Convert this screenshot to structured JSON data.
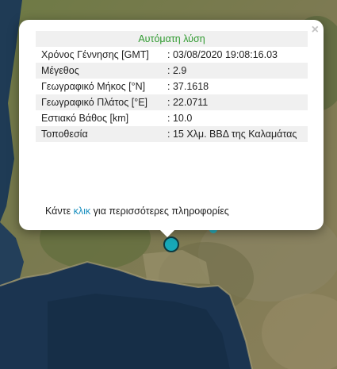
{
  "popup": {
    "title": "Αυτόματη λύση",
    "close_label": "×",
    "rows": [
      {
        "label": "Χρόνος Γέννησης [GMT]",
        "value": ": 03/08/2020 19:08:16.03"
      },
      {
        "label": "Μέγεθος",
        "value": ": 2.9"
      },
      {
        "label": "Γεωγραφικό Μήκος [°N]",
        "value": ": 37.1618"
      },
      {
        "label": "Γεωγραφικό Πλάτος [°E]",
        "value": ": 22.0711"
      },
      {
        "label": "Εστιακό Βάθος [km]",
        "value": ": 10.0"
      },
      {
        "label": "Τοποθεσία",
        "value": ": 15 Χλμ. ΒΒΔ της Καλαμάτας"
      }
    ],
    "more_prefix": "Κάντε ",
    "more_link": "κλικ",
    "more_suffix": " για περισσότερες πληροφορίες"
  },
  "colors": {
    "title": "#2f9a2f",
    "link": "#1a8fbf",
    "marker": "#17a9b8"
  }
}
